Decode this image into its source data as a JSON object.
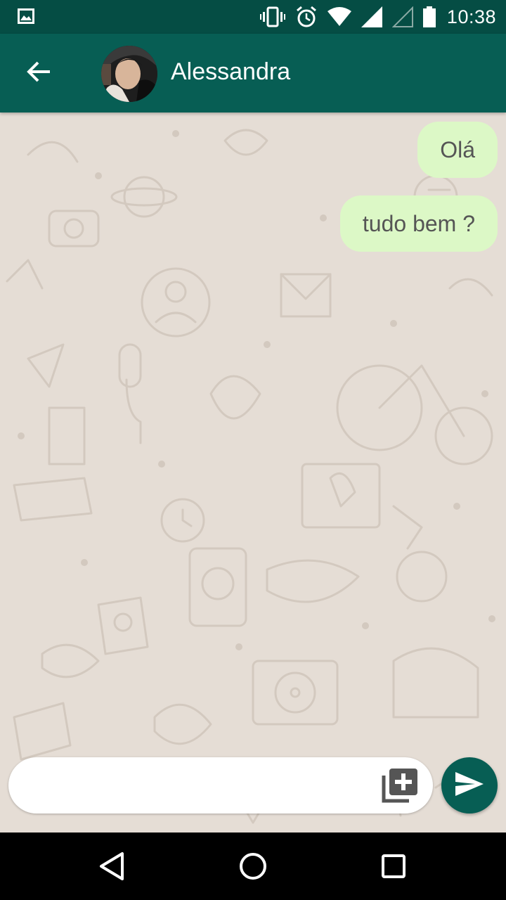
{
  "status_bar": {
    "time": "10:38",
    "icons": [
      "image-icon",
      "vibrate-icon",
      "alarm-icon",
      "wifi-icon",
      "signal-icon",
      "signal-empty-icon",
      "battery-icon"
    ]
  },
  "header": {
    "contact_name": "Alessandra",
    "back_icon": "arrow-back-icon",
    "avatar": "profile-photo"
  },
  "messages": [
    {
      "text": "Olá",
      "direction": "outgoing"
    },
    {
      "text": "tudo bem ?",
      "direction": "outgoing"
    }
  ],
  "composer": {
    "value": "",
    "placeholder": "",
    "attach_icon": "add-to-photos-icon",
    "send_icon": "send-icon"
  },
  "nav_bar": {
    "icons": [
      "nav-back-icon",
      "nav-home-icon",
      "nav-recents-icon"
    ]
  },
  "colors": {
    "primary_dark": "#054d44",
    "primary": "#075e54",
    "chat_background": "#e5ddd5",
    "outgoing_bubble": "#dcf8c6"
  }
}
